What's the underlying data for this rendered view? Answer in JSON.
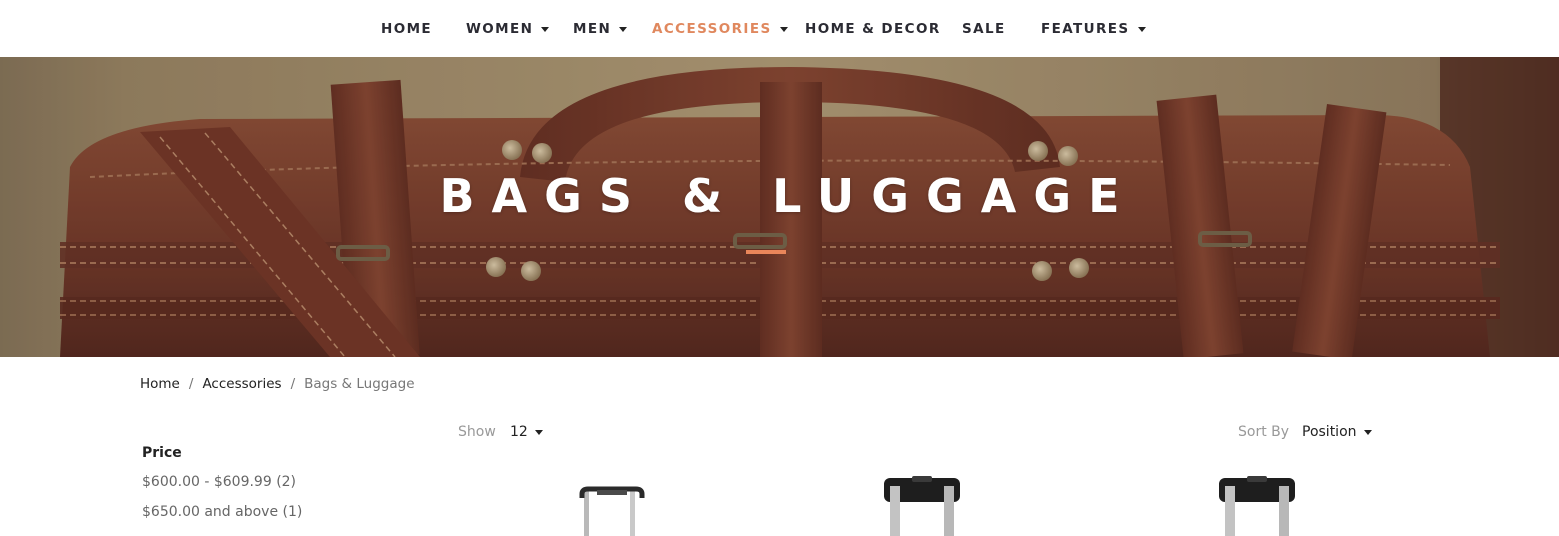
{
  "nav": {
    "items": [
      {
        "label": "HOME",
        "has_dropdown": false,
        "active": false
      },
      {
        "label": "WOMEN",
        "has_dropdown": true,
        "active": false
      },
      {
        "label": "MEN",
        "has_dropdown": true,
        "active": false
      },
      {
        "label": "ACCESSORIES",
        "has_dropdown": true,
        "active": true
      },
      {
        "label": "HOME & DECOR",
        "has_dropdown": false,
        "active": false
      },
      {
        "label": "SALE",
        "has_dropdown": false,
        "active": false
      },
      {
        "label": "FEATURES",
        "has_dropdown": true,
        "active": false
      }
    ],
    "active_color": "#e0885e"
  },
  "hero": {
    "title": "BAGS & LUGGAGE",
    "underline_color": "#e9865a"
  },
  "breadcrumb": {
    "items": [
      "Home",
      "Accessories",
      "Bags & Luggage"
    ],
    "separator": "/"
  },
  "filters": {
    "price": {
      "title": "Price",
      "options": [
        "$600.00 - $609.99 (2)",
        "$650.00 and above (1)"
      ]
    }
  },
  "toolbar": {
    "show_label": "Show",
    "show_value": "12",
    "sort_label": "Sort By",
    "sort_value": "Position"
  },
  "products": [
    {
      "icon": "rolling-suitcase-icon"
    },
    {
      "icon": "rolling-suitcase-icon"
    },
    {
      "icon": "rolling-suitcase-icon"
    }
  ]
}
